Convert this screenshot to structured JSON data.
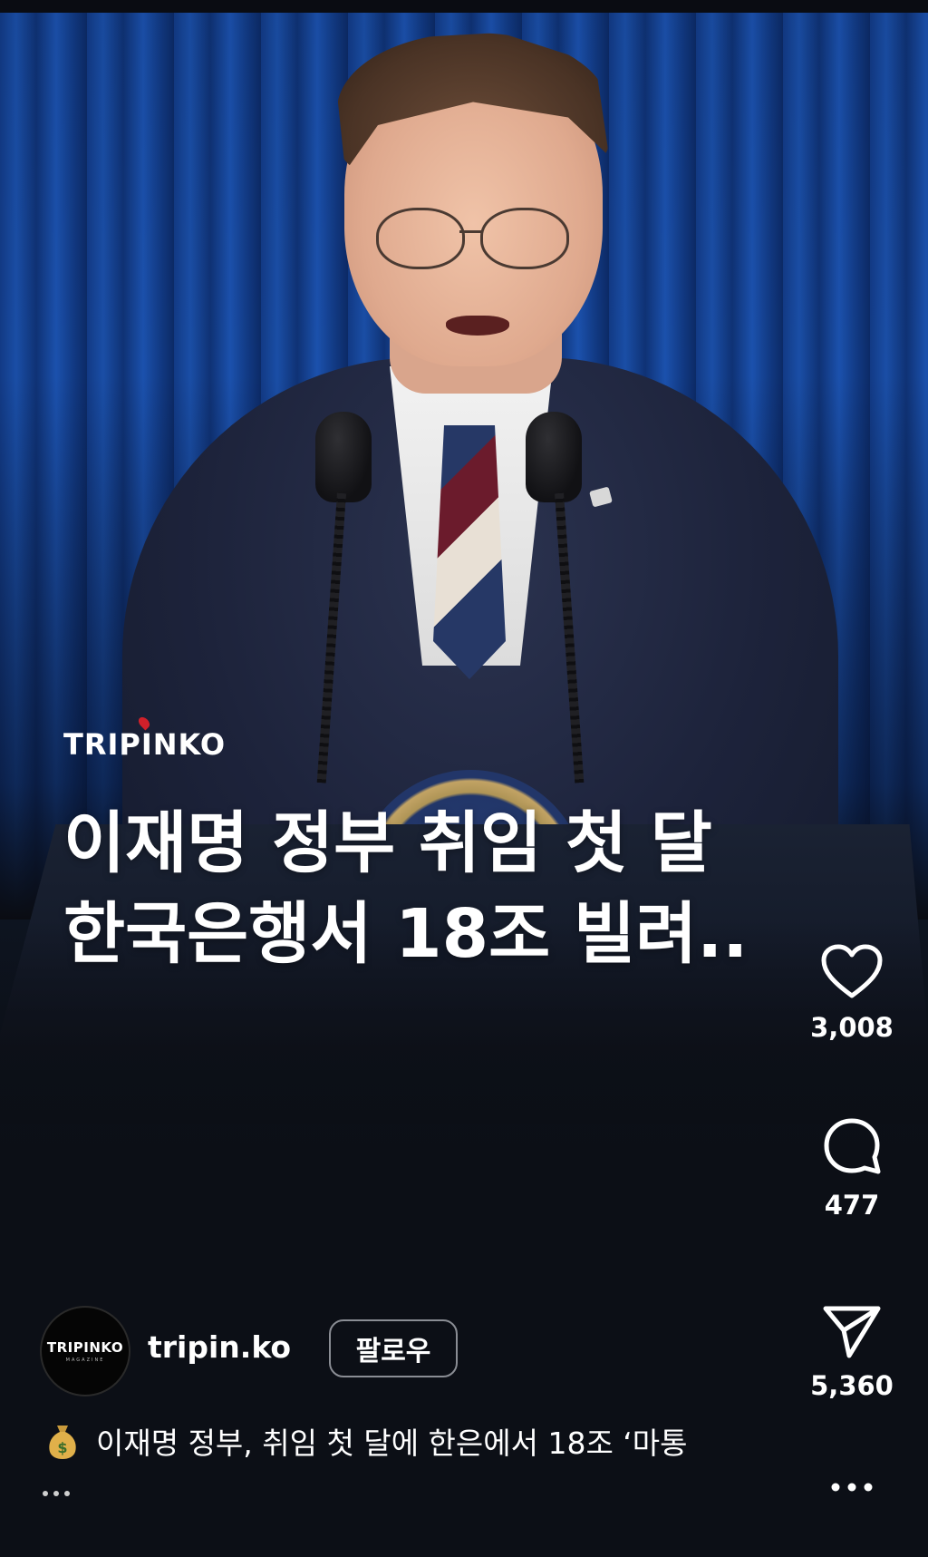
{
  "post": {
    "brand_logo": "TRIPINKO",
    "headline_lines": [
      "이재명 정부 취임 첫 달",
      "한국은행서 18조 빌려.."
    ],
    "caption": "이재명 정부, 취임 첫 달에 한은에서 18조 ‘마통"
  },
  "author": {
    "username": "tripin.ko",
    "avatar_text": "TRIPINKO",
    "avatar_subtext": "MAGAZINE",
    "follow_label": "팔로우"
  },
  "actions": {
    "likes": "3,008",
    "comments": "477",
    "shares": "5,360"
  },
  "icons": {
    "like": "heart-icon",
    "comment": "comment-bubble-icon",
    "share": "paper-plane-icon",
    "more": "more-dots-icon",
    "caption_emoji": "money-bag-icon"
  },
  "colors": {
    "background": "#0c0f16",
    "text": "#ffffff",
    "follow_border": "#8a8d94",
    "logo_pin": "#d0202a"
  }
}
